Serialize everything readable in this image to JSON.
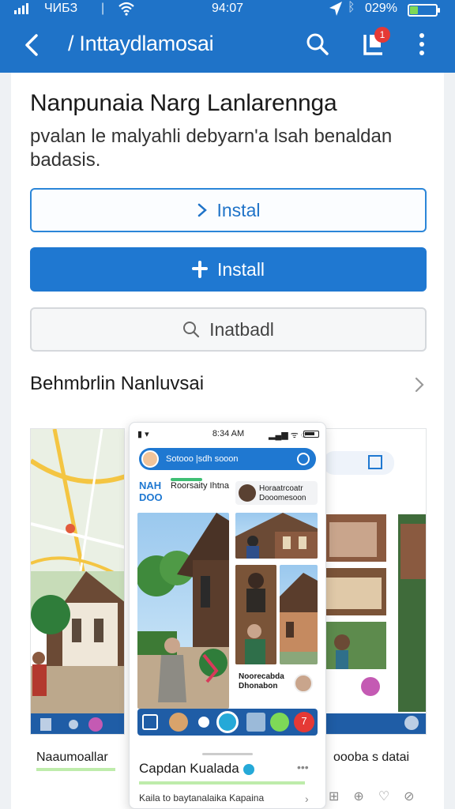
{
  "status_bar": {
    "carrier": "ЧИБЗ",
    "time": "94:07",
    "battery_text": "029%",
    "battery_level": 0.29
  },
  "header": {
    "title": "/ Inttaydlamosai",
    "notification_count": "1"
  },
  "app": {
    "heading": "Nanpunaia Narg Lanlarennga",
    "description": "pvalan le malyahli debyarn'a lsah benaldan badasis."
  },
  "buttons": {
    "outline_label": "Instal",
    "primary_label": "Install",
    "secondary_label": "Inatbadl"
  },
  "section": {
    "title": "Behmbrlin Nanluvsai"
  },
  "screenshot_left": {
    "caption": "Naaumoallar"
  },
  "screenshot_mid": {
    "status_time": "8:34 AM",
    "search_text": "Sotooo |sdh sooon",
    "post_user_1": "NAH",
    "post_user_1b": "DOO",
    "post_name_1": "Roorsaity Ihtna",
    "post_name_2": "Horaatrcoatr\nDooomesoon",
    "caption_text": "Noorecabda\nDhonabon",
    "foot_title": "Capdan Kualada",
    "foot_text": "Kaila to baytanalaika Kapaina",
    "tab_badge": "7"
  },
  "screenshot_right": {
    "caption": "oooba s datai"
  }
}
